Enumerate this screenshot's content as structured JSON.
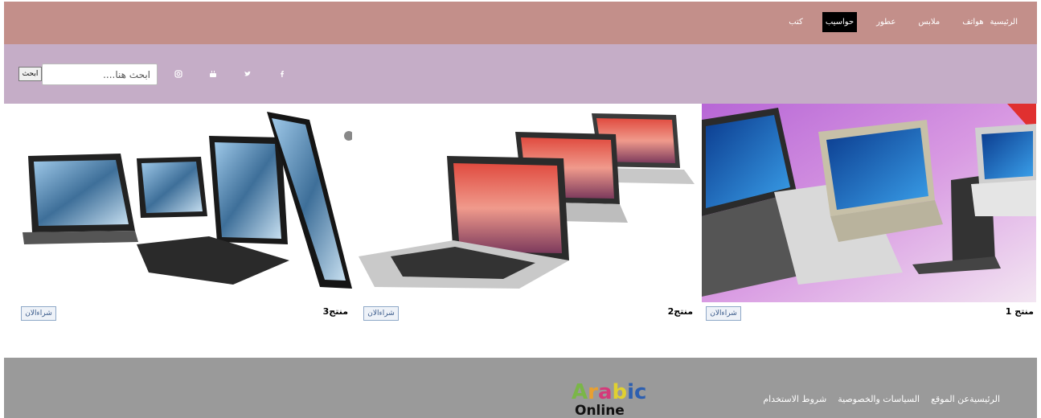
{
  "nav": {
    "items": [
      {
        "label": "الرئيسية",
        "active": false
      },
      {
        "label": "هواتف",
        "active": false
      },
      {
        "label": "ملابس",
        "active": false
      },
      {
        "label": "عطور",
        "active": false
      },
      {
        "label": "حواسيب",
        "active": true
      },
      {
        "label": "كتب",
        "active": false
      }
    ]
  },
  "search": {
    "placeholder": "ابحث هنا....",
    "button_label": "ابحث"
  },
  "social": {
    "icons": [
      "instagram-icon",
      "youtube-icon",
      "twitter-icon",
      "facebook-icon"
    ]
  },
  "products": [
    {
      "name": "منتج 1",
      "button_label": "شراءالان"
    },
    {
      "name": "منتج2",
      "button_label": "شراءالان"
    },
    {
      "name": "منتج3",
      "button_label": "شراءالان"
    }
  ],
  "footer": {
    "links": [
      "الرئيسية",
      "عن الموقع",
      "السياسات والخصوصية",
      "شروط الاستخدام"
    ],
    "logo_word": "Arabic",
    "logo_sub": "Online"
  },
  "colors": {
    "topnav": "#c38f8a",
    "subbar": "#c5adc7",
    "footer": "#9a9a9a",
    "active_nav": "#000000"
  }
}
